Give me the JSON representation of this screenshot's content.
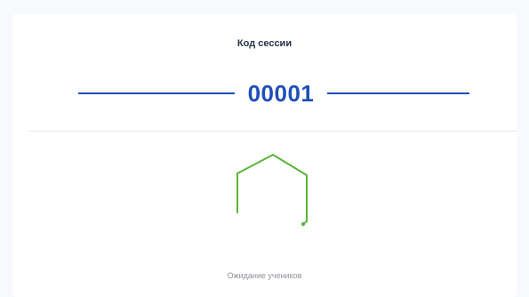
{
  "session": {
    "title": "Код сессии",
    "code": "00001"
  },
  "status": {
    "text": "Ожидание учеников",
    "spinner_icon": "loading-hexagon-icon",
    "spinner_color": "#5ab339"
  },
  "colors": {
    "accent": "#1f4fb7",
    "background": "#f7f9fd",
    "card": "#ffffff"
  }
}
